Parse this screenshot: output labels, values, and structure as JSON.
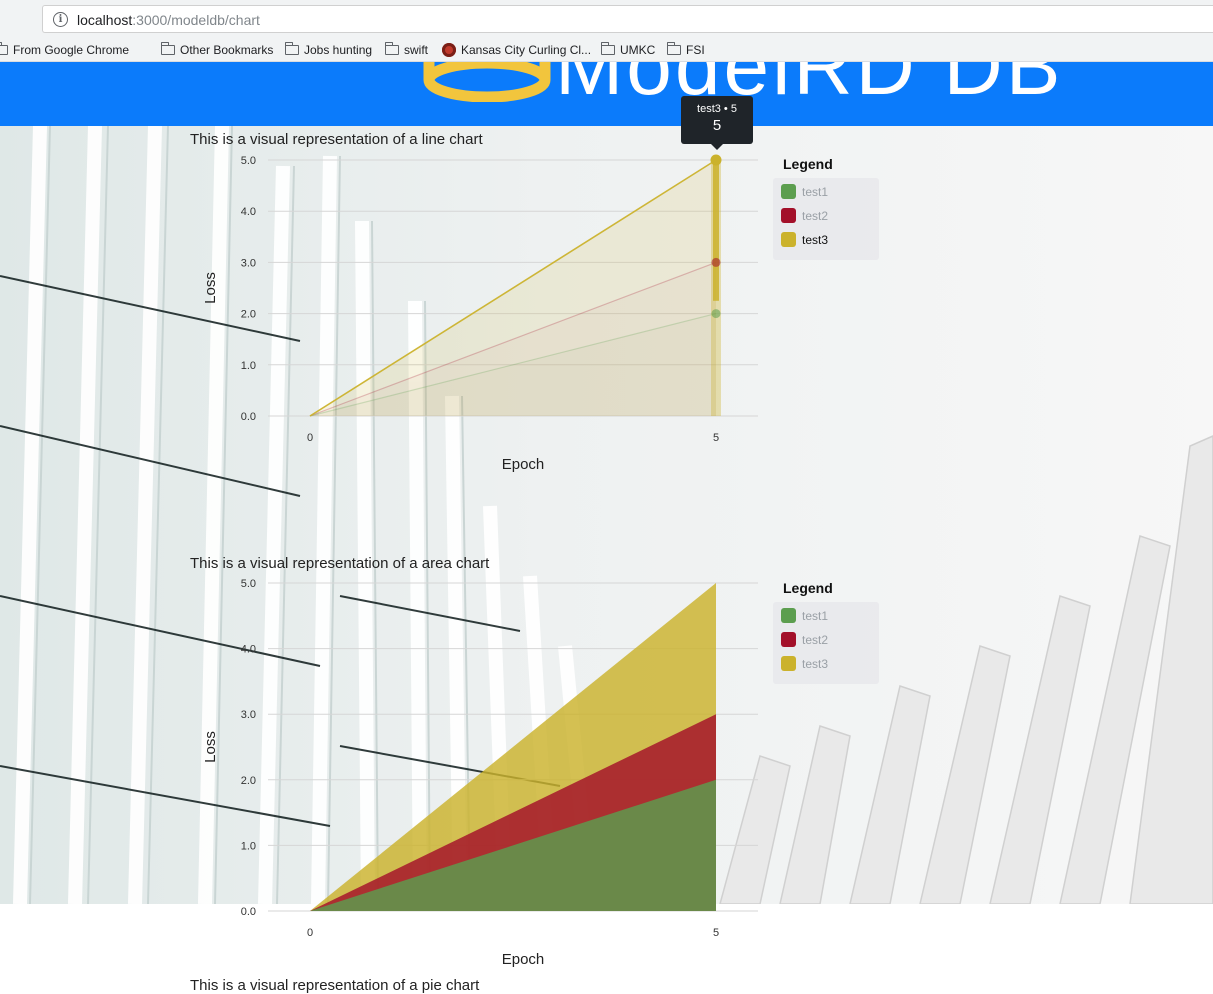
{
  "browser": {
    "url_host": "localhost",
    "url_rest": ":3000/modeldb/chart",
    "bookmarks": [
      {
        "label": "From Google Chrome",
        "icon": "folder-icon"
      },
      {
        "label": "Other Bookmarks",
        "icon": "folder-icon"
      },
      {
        "label": "Jobs hunting",
        "icon": "folder-icon"
      },
      {
        "label": "swift",
        "icon": "folder-icon"
      },
      {
        "label": "Kansas City Curling Cl...",
        "icon": "site-favicon"
      },
      {
        "label": "UMKC",
        "icon": "folder-icon"
      },
      {
        "label": "FSI",
        "icon": "folder-icon"
      }
    ]
  },
  "header": {
    "brand": "ModelRD DB",
    "background_color": "#0b7bfb",
    "logo_color": "#f2c53d"
  },
  "line_section": {
    "caption": "This is a visual representation of a line chart",
    "legend_title": "Legend",
    "legend": [
      {
        "name": "test1",
        "color": "#5c9e4f",
        "faded": true
      },
      {
        "name": "test2",
        "color": "#a3102a",
        "faded": true
      },
      {
        "name": "test3",
        "color": "#cbb22c",
        "faded": false
      }
    ],
    "tooltip": {
      "series_line": "test3 • 5",
      "value": "5"
    }
  },
  "area_section": {
    "caption": "This is a visual representation of a area chart",
    "legend_title": "Legend",
    "legend": [
      {
        "name": "test1",
        "color": "#5c9e4f",
        "faded": true
      },
      {
        "name": "test2",
        "color": "#a3102a",
        "faded": true
      },
      {
        "name": "test3",
        "color": "#cbb22c",
        "faded": true
      }
    ]
  },
  "pie_section": {
    "caption": "This is a visual representation of a pie chart"
  },
  "chart_data": [
    {
      "type": "line",
      "xlabel": "Epoch",
      "ylabel": "Loss",
      "x": [
        0,
        5
      ],
      "xticks": [
        "0",
        "5"
      ],
      "ylim": [
        0,
        5
      ],
      "yticks": [
        "0.0",
        "1.0",
        "2.0",
        "3.0",
        "4.0",
        "5.0"
      ],
      "grid": true,
      "series": [
        {
          "name": "test1",
          "values": [
            0,
            2
          ],
          "color": "#5c9e4f"
        },
        {
          "name": "test2",
          "values": [
            0,
            3
          ],
          "color": "#a3102a"
        },
        {
          "name": "test3",
          "values": [
            0,
            5
          ],
          "color": "#cbb22c"
        }
      ],
      "highlighted_series": "test3",
      "hovered_x": 5
    },
    {
      "type": "area",
      "xlabel": "Epoch",
      "ylabel": "Loss",
      "x": [
        0,
        5
      ],
      "xticks": [
        "0",
        "5"
      ],
      "ylim": [
        0,
        5
      ],
      "yticks": [
        "0.0",
        "1.0",
        "2.0",
        "3.0",
        "4.0",
        "5.0"
      ],
      "grid": true,
      "series": [
        {
          "name": "test1",
          "values": [
            0,
            2
          ],
          "color": "#5c9e4f"
        },
        {
          "name": "test2",
          "values": [
            0,
            3
          ],
          "color": "#a3102a"
        },
        {
          "name": "test3",
          "values": [
            0,
            5
          ],
          "color": "#cbb22c"
        }
      ]
    }
  ]
}
